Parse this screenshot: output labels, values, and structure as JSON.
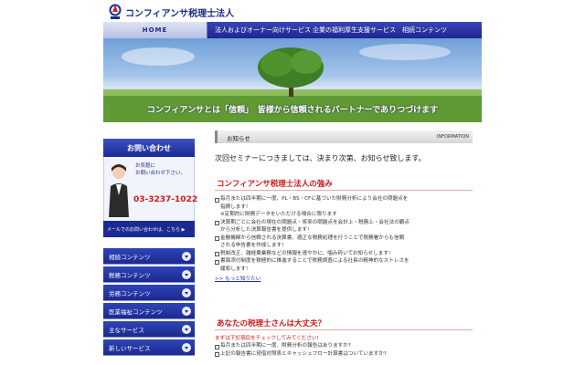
{
  "header": {
    "logo_text": "コンフィアンサ税理士法人",
    "nav": [
      "HOME",
      "法人およびオーナー向けサービス",
      "企業の福利厚生支援サービス",
      "相続コンテンツ"
    ],
    "hero_caption": "コンフィアンサとは「信頼」　皆様から信頼されるパートナーでありつづけます"
  },
  "sidebar": {
    "contact_title": "お問い合わせ",
    "contact_note_1": "お気軽に",
    "contact_note_2": "お問い合わせ下さい。",
    "phone": "03-3237-1022",
    "mail_button": "メールでのお問い合わせは、こちら ▶",
    "menu": [
      "相続コンテンツ",
      "税務コンテンツ",
      "労務コンテンツ",
      "医業福祉コンテンツ",
      "主なサービス",
      "新しいサービス"
    ]
  },
  "main": {
    "news_title": "お知らせ",
    "news_tag": "INFORMATION",
    "news_text": "次回セミナーにつきましては、決まり次第、お知らせ致します。",
    "section1_title": "コンフィアンサ税理士法人の強み",
    "section1_items": [
      "毎月または四半期に一度、PL・BS・CFに基づいた財務分析により会社の問題点を",
      "指摘します!",
      "※定期的に財務データをいただける場合に限ります",
      "決算期ごとに会社の現在の問題点・将来の問題点を会計上・税務上・会社法の観点",
      "から分析した決算報告書を提供します!",
      "金融機関から信頼される決算書、適正な税務処理を行うことで税務署からも信頼",
      "される申告書を作成します!",
      "税制改正、雑経費業務などの情報を速やかに、噛み砕いてお知らせします!",
      "書面添付制度を積極的に推進することで税務調査による社長の精神的なストレスを",
      "緩和します!"
    ],
    "more_link": ">> もっと知りたい",
    "section2_title": "あなたの税理士さんは大丈夫？",
    "section2_sub": "まずは下記項目をチェックしてみてください!",
    "section2_items": [
      "毎月または四半期に一度、財務分析の報告はありますか?",
      "上記の報告書に貸借対照表とキャッシュフロー計算書はついていますか?"
    ]
  },
  "colors": {
    "brand_blue": "#1b2a93",
    "accent_red": "#d01818"
  }
}
